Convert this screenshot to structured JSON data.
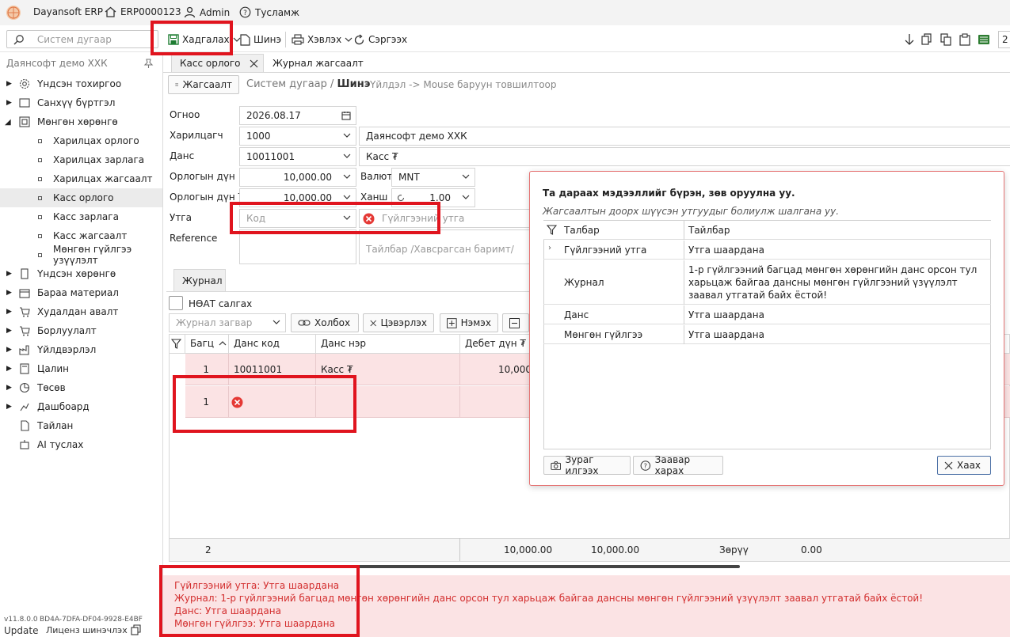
{
  "titlebar": {
    "app_name": "Dayansoft ERP",
    "db_name": "ERP0000123",
    "user": "Admin",
    "help": "Тусламж"
  },
  "toolbar": {
    "search_placeholder": "Систем дугаар",
    "save": "Хадгалах",
    "new": "Шинэ",
    "print": "Хэвлэх",
    "refresh": "Сэргээх",
    "right_num": "2"
  },
  "sidebar": {
    "company": "Даянсофт демо ХХК",
    "items": [
      {
        "label": "Үндсэн тохиргоо"
      },
      {
        "label": "Санхүү бүртгэл"
      },
      {
        "label": "Мөнгөн хөрөнгө"
      },
      {
        "label": "Харилцах орлого"
      },
      {
        "label": "Харилцах зарлага"
      },
      {
        "label": "Харилцах жагсаалт"
      },
      {
        "label": "Касс орлого"
      },
      {
        "label": "Касс зарлага"
      },
      {
        "label": "Касс жагсаалт"
      },
      {
        "label": "Мөнгөн гүйлгээ узүүлэлт"
      },
      {
        "label": "Үндсэн хөрөнгө"
      },
      {
        "label": "Бараа материал"
      },
      {
        "label": "Худалдан авалт"
      },
      {
        "label": "Борлуулалт"
      },
      {
        "label": "Үйлдвэрлэл"
      },
      {
        "label": "Цалин"
      },
      {
        "label": "Төсөв"
      },
      {
        "label": "Дашбоард"
      },
      {
        "label": "Тайлан"
      },
      {
        "label": "AI туслах"
      }
    ],
    "version": "v11.8.0.0",
    "license_code": "BD4A-7DFA-DF04-9928-E4BF",
    "update": "Update",
    "license_update": "Лиценз шинэчлэх"
  },
  "tabs": [
    {
      "label": "Касс орлого"
    },
    {
      "label": "Журнал жагсаалт"
    }
  ],
  "header": {
    "list_button": "Жагсаалт",
    "breadcrumb_base": "Систем дугаар /",
    "breadcrumb_current": "Шинэ",
    "hint": "Үйлдэл -> Mouse баруун товшилтоор"
  },
  "form": {
    "date_label": "Огноо",
    "date_value": "2026.08.17",
    "partner_label": "Харилцагч",
    "partner_code": "1000",
    "partner_name": "Даянсофт демо ХХК",
    "account_label": "Данс",
    "account_code": "10011001",
    "account_name": "Касс ₮",
    "amount_label": "Орлогын дүн",
    "amount_value": "10,000.00",
    "currency_label": "Валют",
    "currency_value": "MNT",
    "amount_mnt_label": "Орлогын дүн ₮",
    "amount_mnt_value": "10,000.00",
    "rate_label": "Ханш",
    "rate_value": "1.00",
    "value_label": "Утга",
    "code_placeholder": "Код",
    "trans_value_placeholder": "Гүйлгээний утга",
    "reference_label": "Reference",
    "desc_placeholder": "Тайлбар /Хавсрагсан баримт/"
  },
  "journal": {
    "tab": "Журнал",
    "vat_checkbox": "НӨАТ салгах",
    "template_placeholder": "Журнал загвар",
    "link_btn": "Холбох",
    "clear_btn": "Цэвэрлэх",
    "add_btn": "Нэмэх",
    "columns": [
      "Багц",
      "Данс код",
      "Данс нэр",
      "Дебет дүн ₮"
    ],
    "rows": [
      {
        "batch": "1",
        "code": "10011001",
        "name": "Касс ₮",
        "debit": "10,000"
      },
      {
        "batch": "1",
        "code": "",
        "name": "",
        "debit": ""
      }
    ],
    "footer": {
      "count": "2",
      "debit": "10,000.00",
      "credit": "10,000.00",
      "diff_label": "Зөрүү",
      "diff": "0.00"
    }
  },
  "errors": [
    "Гүйлгээний утга: Утга шаардана",
    "Журнал: 1-р гүйлгээний багцад мөнгөн хөрөнгийн данс орсон тул харьцаж байгаа дансны мөнгөн гүйлгээний үзүүлэлт заавал утгатай байх ёстой!",
    "Данс: Утга шаардана",
    "Мөнгөн гүйлгээ: Утга шаардана"
  ],
  "popup": {
    "title": "Та дараах мэдээллийг бүрэн, зөв оруулна уу.",
    "subtitle": "Жагсаалтын доорх шүүсэн утгуудыг болиулж шалгана уу.",
    "col_field": "Талбар",
    "col_desc": "Тайлбар",
    "rows": [
      {
        "field": "Гүйлгээний утга",
        "desc": "Утга шаардана"
      },
      {
        "field": "Журнал",
        "desc": "1-р гүйлгээний багцад мөнгөн хөрөнгийн данс орсон тул харьцаж байгаа дансны мөнгөн гүйлгээний үзүүлэлт заавал утгатай байх ёстой!"
      },
      {
        "field": "Данс",
        "desc": "Утга шаардана"
      },
      {
        "field": "Мөнгөн гүйлгээ",
        "desc": "Утга шаардана"
      }
    ],
    "screenshot_btn": "Зураг илгээх",
    "guide_btn": "Заавар харах",
    "close_btn": "Хаах"
  },
  "colors": {
    "error_row_bg": "#fbe3e4",
    "error_text": "#d32f2f",
    "highlight_box": "#e0141e",
    "save_icon": "#1e7d32"
  }
}
